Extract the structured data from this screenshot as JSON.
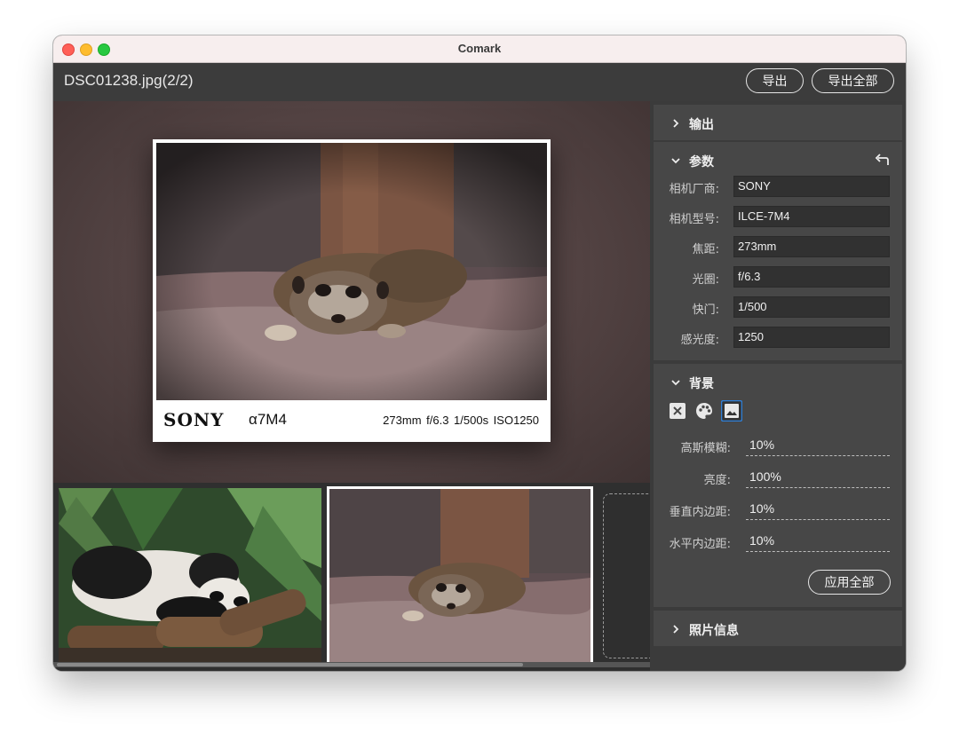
{
  "window": {
    "title": "Comark"
  },
  "toolbar": {
    "filename": "DSC01238.jpg(2/2)",
    "export_label": "导出",
    "export_all_label": "导出全部"
  },
  "preview": {
    "brand": "SONY",
    "model": "α7M4",
    "params_line": "273mm  f/6.3  1/500s  ISO1250"
  },
  "sidebar": {
    "output": {
      "title": "输出",
      "icon": "chevron-right-icon"
    },
    "params": {
      "title": "参数",
      "icon": "chevron-down-icon",
      "reset_icon": "undo-icon",
      "fields": [
        {
          "label": "相机厂商:",
          "value": "SONY"
        },
        {
          "label": "相机型号:",
          "value": "ILCE-7M4"
        },
        {
          "label": "焦距:",
          "value": "273mm"
        },
        {
          "label": "光圈:",
          "value": "f/6.3"
        },
        {
          "label": "快门:",
          "value": "1/500"
        },
        {
          "label": "感光度:",
          "value": "1250"
        }
      ]
    },
    "background": {
      "title": "背景",
      "icon": "chevron-down-icon",
      "options": [
        "none-icon",
        "palette-icon",
        "image-icon"
      ],
      "selected_option": "image-icon",
      "fields": [
        {
          "label": "高斯模糊:",
          "value": "10%"
        },
        {
          "label": "亮度:",
          "value": "100%"
        },
        {
          "label": "垂直内边距:",
          "value": "10%"
        },
        {
          "label": "水平内边距:",
          "value": "10%"
        }
      ],
      "apply_all_label": "应用全部"
    },
    "photo_info": {
      "title": "照片信息",
      "icon": "chevron-right-icon"
    }
  },
  "filmstrip": {
    "thumbnails": [
      "panda-photo",
      "meerkat-photo"
    ],
    "selected_index": 1
  },
  "colors": {
    "accent_selected": "#2f7fd6",
    "panel_bg": "#474747"
  }
}
